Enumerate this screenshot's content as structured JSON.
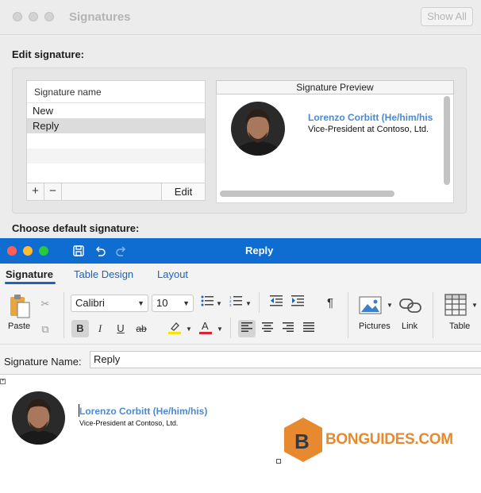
{
  "signatures_window": {
    "title": "Signatures",
    "show_all_label": "Show All",
    "edit_heading": "Edit signature:",
    "list": {
      "header": "Signature name",
      "items": [
        "New",
        "Reply"
      ],
      "selected": "Reply",
      "add_label": "+",
      "remove_label": "−",
      "edit_label": "Edit"
    },
    "preview": {
      "header": "Signature Preview",
      "name": "Lorenzo Corbitt (He/him/his",
      "job_title": "Vice-President at Contoso, Ltd."
    },
    "choose_default_heading": "Choose default signature:"
  },
  "reply_window": {
    "title": "Reply",
    "quick_access_icons": [
      "save-icon",
      "undo-icon",
      "redo-icon"
    ],
    "tabs": [
      {
        "label": "Signature",
        "active": true
      },
      {
        "label": "Table Design",
        "active": false
      },
      {
        "label": "Layout",
        "active": false
      }
    ],
    "ribbon": {
      "paste_label": "Paste",
      "font_name": "Calibri",
      "font_size": "10",
      "bold_label": "B",
      "italic_label": "I",
      "underline_label": "U",
      "strike_label": "ab",
      "pictures_label": "Pictures",
      "link_label": "Link",
      "table_label": "Table",
      "highlight_color": "#f2e600",
      "font_color": "#d9232f"
    },
    "signature_name": {
      "label": "Signature Name:",
      "value": "Reply"
    },
    "editor": {
      "name": "Lorenzo Corbitt (He/him/his)",
      "job_title": "Vice-President at Contoso, Ltd."
    }
  },
  "watermark": {
    "logo_letter": "B",
    "text": "BONGUIDES.COM"
  },
  "colors": {
    "titlebar_blue": "#0f6cd1",
    "accent_blue": "#1d63b8",
    "name_blue": "#4a8ad4",
    "watermark_orange": "#e6892f"
  }
}
